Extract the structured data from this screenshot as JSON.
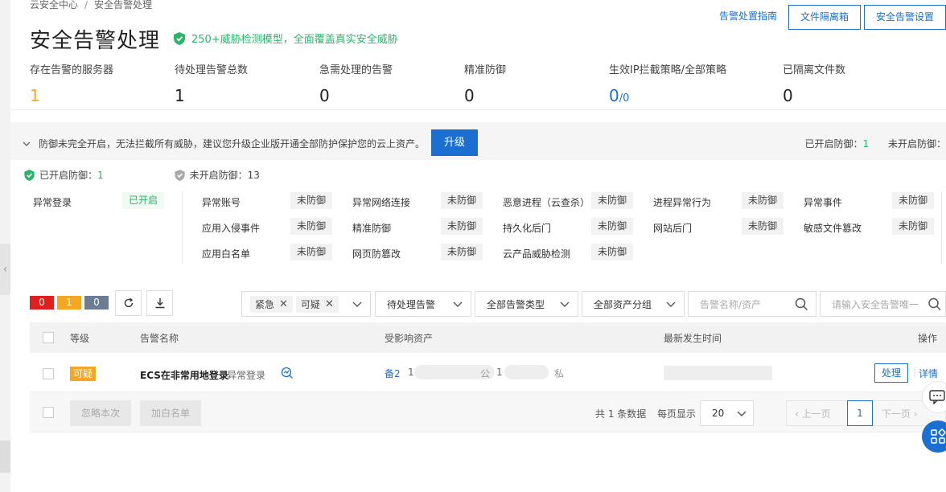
{
  "breadcrumb": {
    "root": "云安全中心",
    "sep": "/",
    "current": "安全告警处理"
  },
  "header": {
    "title": "安全告警处理",
    "badge": "250+威胁检测模型，全面覆盖真实安全威胁",
    "guide_link": "告警处置指南",
    "btn_quarantine": "文件隔离箱",
    "btn_settings": "安全告警设置"
  },
  "stats": [
    {
      "label": "存在告警的服务器",
      "value": "1"
    },
    {
      "label": "待处理告警总数",
      "value": "1"
    },
    {
      "label": "急需处理的告警",
      "value": "0"
    },
    {
      "label": "精准防御",
      "value": "0"
    },
    {
      "label": "生效IP拦截策略/全部策略",
      "value": "0",
      "value_suffix": "/0"
    },
    {
      "label": "已隔离文件数",
      "value": "0"
    }
  ],
  "warning": {
    "text": "防御未完全开启，无法拦截所有威胁，建议您升级企业版开通全部防护保护您的云上资产。",
    "upgrade": "升级",
    "enabled_label": "已开启防御：",
    "enabled_count": "1",
    "disabled_label": "未开启防御："
  },
  "defense_summary": {
    "enabled_label": "已开启防御：",
    "enabled_count": "1",
    "disabled_label": "未开启防御：",
    "disabled_count": "13"
  },
  "protections": {
    "col0": [
      {
        "name": "异常登录",
        "status": "已开启"
      }
    ],
    "col1": [
      {
        "name": "异常账号",
        "status": "未防御"
      },
      {
        "name": "应用入侵事件",
        "status": "未防御"
      },
      {
        "name": "应用白名单",
        "status": "未防御"
      }
    ],
    "col2": [
      {
        "name": "异常网络连接",
        "status": "未防御"
      },
      {
        "name": "精准防御",
        "status": "未防御"
      },
      {
        "name": "网页防篡改",
        "status": "未防御"
      }
    ],
    "col3": [
      {
        "name": "恶意进程（云查杀）",
        "status": "未防御"
      },
      {
        "name": "持久化后门",
        "status": "未防御"
      },
      {
        "name": "云产品威胁检测",
        "status": "未防御"
      }
    ],
    "col4": [
      {
        "name": "进程异常行为",
        "status": "未防御"
      },
      {
        "name": "网站后门",
        "status": "未防御"
      }
    ],
    "col5": [
      {
        "name": "异常事件",
        "status": "未防御"
      },
      {
        "name": "敏感文件篡改",
        "status": "未防御"
      }
    ]
  },
  "level_counts": {
    "urgent": "0",
    "suspicious": "1",
    "reminder": "0"
  },
  "filters": {
    "chip_urgent": "紧急",
    "chip_suspicious": "可疑",
    "status": "待处理告警",
    "type": "全部告警类型",
    "group": "全部资产分组",
    "search_placeholder": "告警名称/资产",
    "search2_placeholder": "请输入安全告警唯一"
  },
  "table": {
    "headers": {
      "level": "等级",
      "name": "告警名称",
      "asset": "受影响资产",
      "time": "最新发生时间",
      "action": "操作"
    },
    "rows": [
      {
        "level": "可疑",
        "name": "ECS在非常用地登录",
        "type": "异常登录",
        "asset_prefix": "备2",
        "asset_mid1": "1",
        "asset_pub": "公",
        "asset_mid2": "1",
        "asset_priv": "私",
        "action_handle": "处理",
        "action_detail": "详情"
      }
    ]
  },
  "footer": {
    "ignore": "忽略本次",
    "whitelist": "加白名单",
    "total": "共 1 条数据",
    "per_page_label": "每页显示",
    "per_page": "20",
    "prev": "上一页",
    "page": "1",
    "next": "下一页"
  },
  "colors": {
    "primary": "#1a6fd1",
    "success": "#2bb56b",
    "urgent": "#e02020",
    "suspicious": "#f5a623",
    "reminder": "#6b7c93"
  }
}
